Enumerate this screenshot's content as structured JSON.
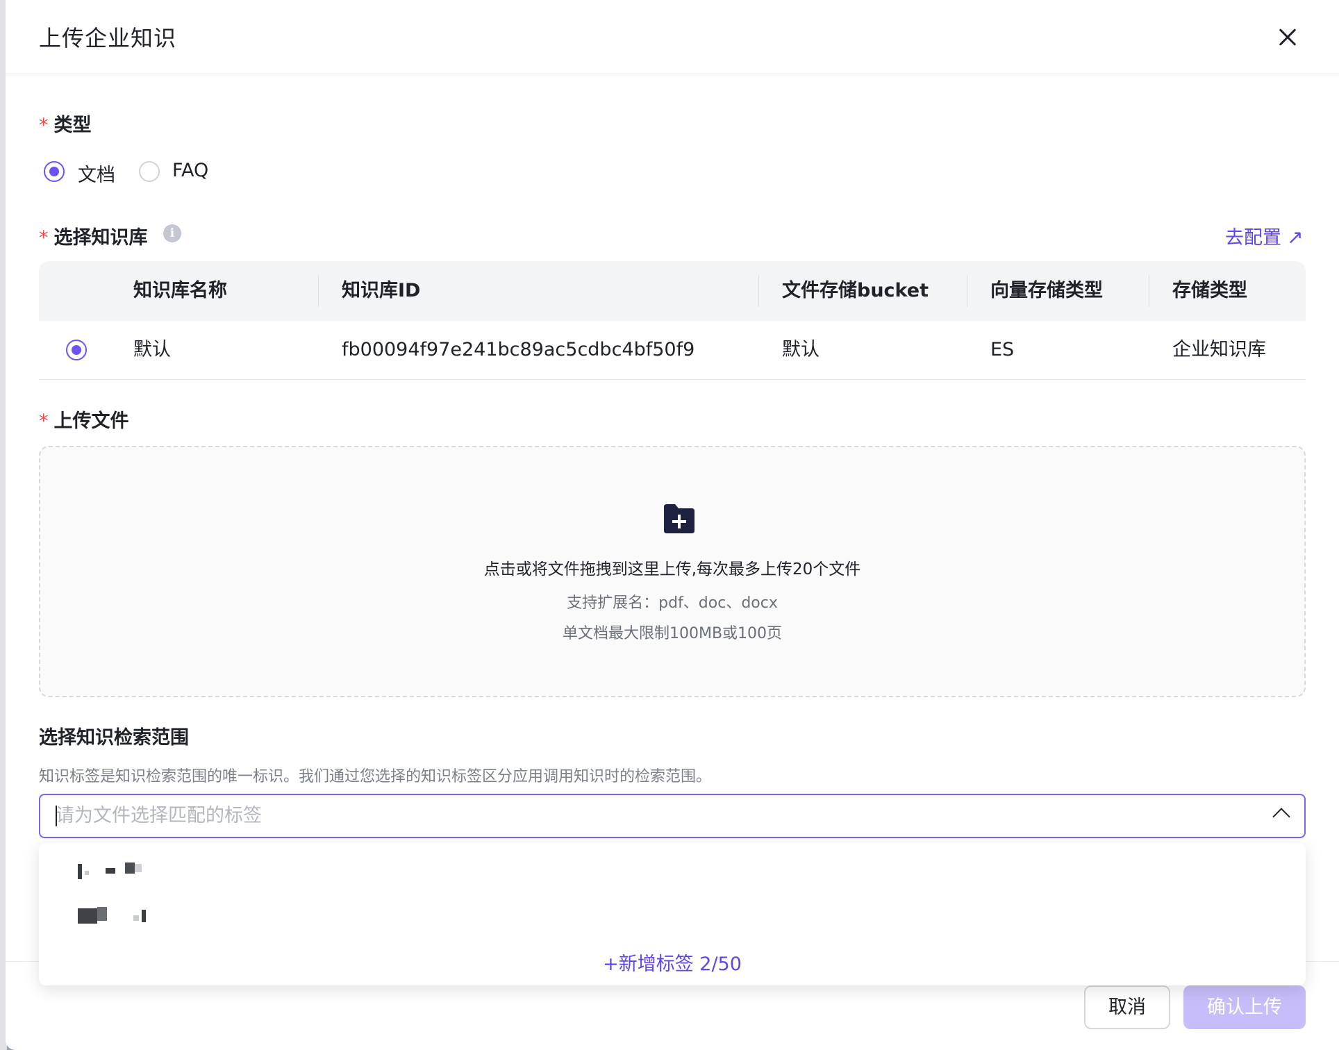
{
  "dialog": {
    "title": "上传企业知识"
  },
  "type_field": {
    "label": "类型",
    "options": [
      {
        "label": "文档",
        "selected": true
      },
      {
        "label": "FAQ",
        "selected": false
      }
    ]
  },
  "kb_field": {
    "label": "选择知识库",
    "info_icon": "i",
    "config_link": "去配置",
    "config_link_icon": "↗"
  },
  "kb_table": {
    "headers": [
      "知识库名称",
      "知识库ID",
      "文件存储bucket",
      "向量存储类型",
      "存储类型"
    ],
    "rows": [
      {
        "selected": true,
        "name": "默认",
        "id": "fb00094f97e241bc89ac5cdbc4bf50f9",
        "bucket": "默认",
        "vector_type": "ES",
        "storage_type": "企业知识库"
      }
    ]
  },
  "upload_field": {
    "label": "上传文件",
    "main_text": "点击或将文件拖拽到这里上传,每次最多上传20个文件",
    "ext_text": "支持扩展名：pdf、doc、docx",
    "limit_text": "单文档最大限制100MB或100页"
  },
  "scope": {
    "title": "选择知识检索范围",
    "description": "知识标签是知识检索范围的唯一标识。我们通过您选择的知识标签区分应用调用知识时的检索范围。",
    "placeholder": "请为文件选择匹配的标签",
    "add_tag": "+新增标签 2/50"
  },
  "footer": {
    "cancel": "取消",
    "confirm": "确认上传"
  },
  "colors": {
    "accent": "#6f52f4",
    "link": "#6046ea",
    "required": "#f04c4c",
    "confirm_disabled": "#c7bdfa"
  }
}
